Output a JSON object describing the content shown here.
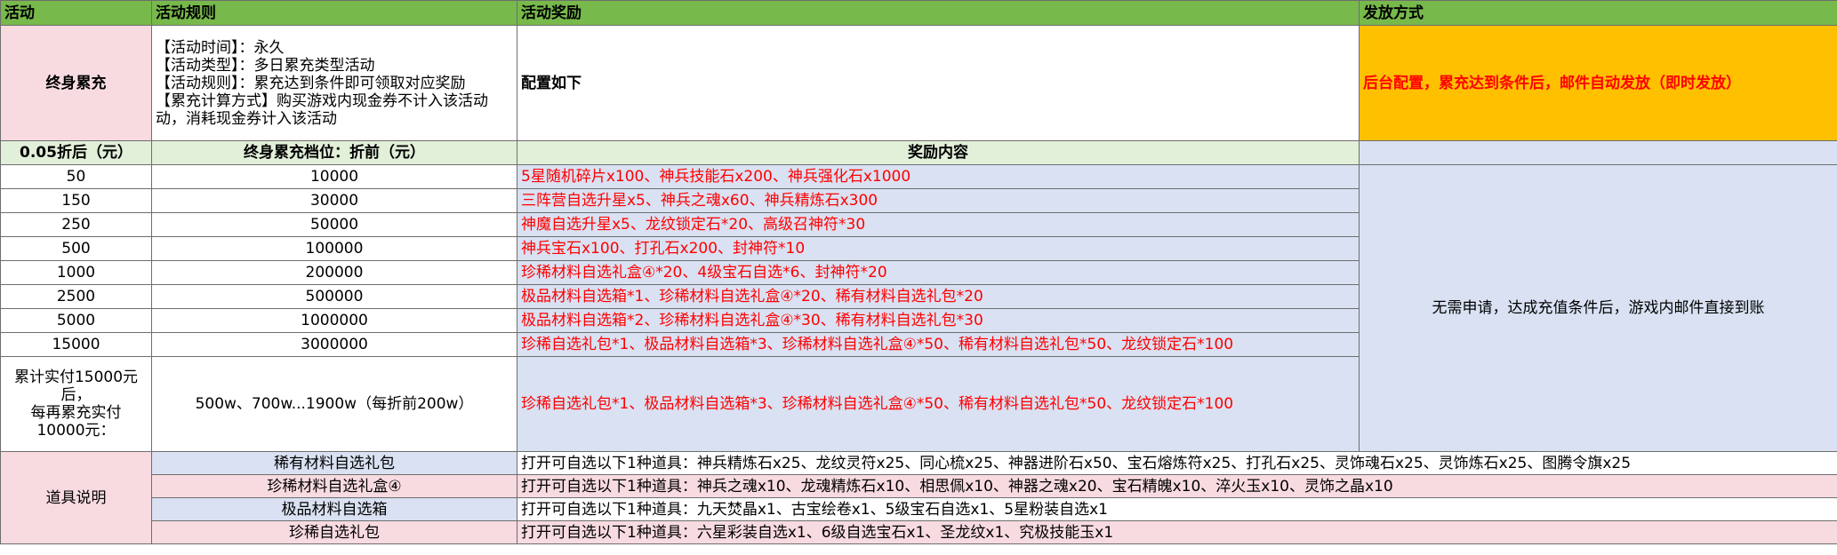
{
  "headers": {
    "activity": "活动",
    "rules": "活动规则",
    "rewards": "活动奖励",
    "distribution": "发放方式"
  },
  "main": {
    "activity_name": "终身累充",
    "rules_lines": [
      "【活动时间】：永久",
      "【活动类型】：多日累充类型活动",
      "【活动规则】：累充达到条件即可领取对应奖励",
      "【累充计算方式】购买游戏内现金券不计入该活动",
      "动，消耗现金券计入该活动"
    ],
    "reward_config": "配置如下",
    "distribution_text": "后台配置，累充达到条件后，邮件自动发放（即时发放）"
  },
  "tier_header": {
    "col1": "0.05折后（元）",
    "col2": "终身累充档位：折前（元）",
    "col3": "奖励内容"
  },
  "tiers": [
    {
      "after": "50",
      "before": "10000",
      "reward": "5星随机碎片x100、神兵技能石x200、神兵强化石x1000"
    },
    {
      "after": "150",
      "before": "30000",
      "reward": "三阵营自选升星x5、神兵之魂x60、神兵精炼石x300"
    },
    {
      "after": "250",
      "before": "50000",
      "reward": "神魔自选升星x5、龙纹锁定石*20、高级召神符*30"
    },
    {
      "after": "500",
      "before": "100000",
      "reward": "神兵宝石x100、打孔石x200、封神符*10"
    },
    {
      "after": "1000",
      "before": "200000",
      "reward": "珍稀材料自选礼盒④*20、4级宝石自选*6、封神符*20"
    },
    {
      "after": "2500",
      "before": "500000",
      "reward": "极品材料自选箱*1、珍稀材料自选礼盒④*20、稀有材料自选礼包*20"
    },
    {
      "after": "5000",
      "before": "1000000",
      "reward": "极品材料自选箱*2、珍稀材料自选礼盒④*30、稀有材料自选礼包*30"
    },
    {
      "after": "15000",
      "before": "3000000",
      "reward": "珍稀自选礼包*1、极品材料自选箱*3、珍稀材料自选礼盒④*50、稀有材料自选礼包*50、龙纹锁定石*100"
    }
  ],
  "extra_tier": {
    "after_lines": [
      "累计实付15000元",
      "后，",
      "每再累充实付",
      "10000元："
    ],
    "before": "500w、700w...1900w（每折前200w）",
    "reward": "珍稀自选礼包*1、极品材料自选箱*3、珍稀材料自选礼盒④*50、稀有材料自选礼包*50、龙纹锁定石*100"
  },
  "distribution_note": "无需申请，达成充值条件后，游戏内邮件直接到账",
  "items_section": {
    "label": "道具说明",
    "items": [
      {
        "name": "稀有材料自选礼包",
        "desc": "打开可自选以下1种道具：神兵精炼石x25、龙纹灵符x25、同心梳x25、神器进阶石x50、宝石熔炼符x25、打孔石x25、灵饰魂石x25、灵饰炼石x25、图腾令旗x25"
      },
      {
        "name": "珍稀材料自选礼盒④",
        "desc": "打开可自选以下1种道具：神兵之魂x10、龙魂精炼石x10、相思佩x10、神器之魂x20、宝石精魄x10、淬火玉x10、灵饰之晶x10"
      },
      {
        "name": "极品材料自选箱",
        "desc": "打开可自选以下1种道具：九天焚晶x1、古宝绘卷x1、5级宝石自选x1、5星粉装自选x1"
      },
      {
        "name": "珍稀自选礼包",
        "desc": "打开可自选以下1种道具：六星彩装自选x1、6级自选宝石x1、圣龙纹x1、究极技能玉x1"
      }
    ]
  },
  "colors": {
    "header_green": "#77b94b",
    "pink": "#f8dbe0",
    "lavender": "#d9e1f2",
    "light_green": "#e2efd9",
    "orange": "#ffc000",
    "reward_red": "#ff0000"
  }
}
